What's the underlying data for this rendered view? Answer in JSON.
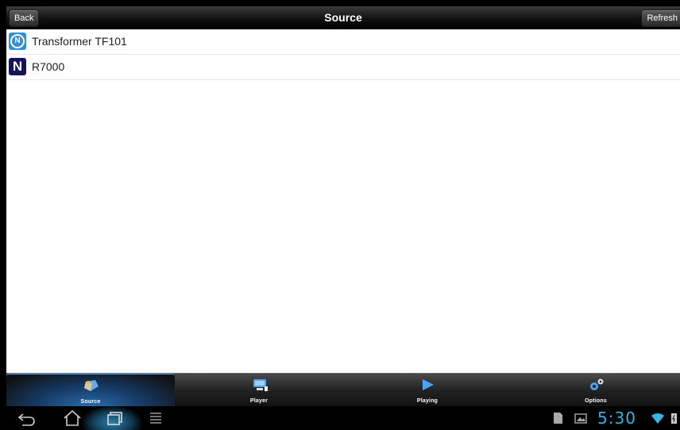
{
  "titlebar": {
    "back_label": "Back",
    "title": "Source",
    "refresh_label": "Refresh"
  },
  "sources": [
    {
      "name": "Transformer TF101",
      "icon": "nero-gear-icon"
    },
    {
      "name": "R7000",
      "icon": "n-logo-icon"
    }
  ],
  "tabs": [
    {
      "label": "Source",
      "icon": "source-icon",
      "active": true
    },
    {
      "label": "Player",
      "icon": "player-icon",
      "active": false
    },
    {
      "label": "Playing",
      "icon": "play-icon",
      "active": false
    },
    {
      "label": "Options",
      "icon": "gears-icon",
      "active": false
    }
  ],
  "system_bar": {
    "clock": "5:30",
    "accent_color": "#33b5e5"
  }
}
